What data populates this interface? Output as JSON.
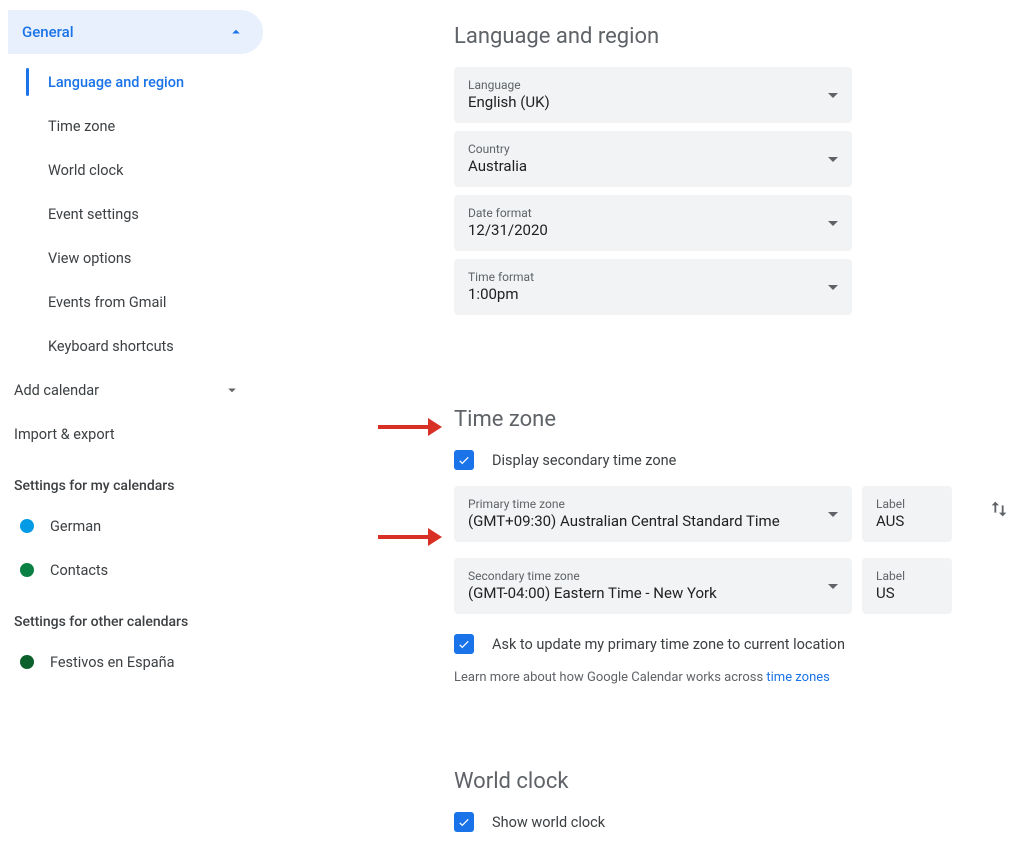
{
  "sidebar": {
    "general_label": "General",
    "items": [
      "Language and region",
      "Time zone",
      "World clock",
      "Event settings",
      "View options",
      "Events from Gmail",
      "Keyboard shortcuts"
    ],
    "add_calendar": "Add calendar",
    "import_export": "Import & export",
    "my_calendars_title": "Settings for my calendars",
    "my_calendars": [
      {
        "name": "German",
        "color": "#039be5"
      },
      {
        "name": "Contacts",
        "color": "#0b8043"
      }
    ],
    "other_calendars_title": "Settings for other calendars",
    "other_calendars": [
      {
        "name": "Festivos en España",
        "color": "#0b8043"
      }
    ]
  },
  "lang_region": {
    "title": "Language and region",
    "language": {
      "label": "Language",
      "value": "English (UK)"
    },
    "country": {
      "label": "Country",
      "value": "Australia"
    },
    "date_format": {
      "label": "Date format",
      "value": "12/31/2020"
    },
    "time_format": {
      "label": "Time format",
      "value": "1:00pm"
    }
  },
  "time_zone": {
    "title": "Time zone",
    "display_secondary": "Display secondary time zone",
    "primary": {
      "label": "Primary time zone",
      "value": "(GMT+09:30) Australian Central Standard Time"
    },
    "primary_label_field": {
      "label": "Label",
      "value": "AUS"
    },
    "secondary": {
      "label": "Secondary time zone",
      "value": "(GMT-04:00) Eastern Time - New York"
    },
    "secondary_label_field": {
      "label": "Label",
      "value": "US"
    },
    "ask_update": "Ask to update my primary time zone to current location",
    "learn_more_text": "Learn more about how Google Calendar works across ",
    "learn_more_link": "time zones"
  },
  "world_clock": {
    "title": "World clock",
    "show": "Show world clock"
  }
}
